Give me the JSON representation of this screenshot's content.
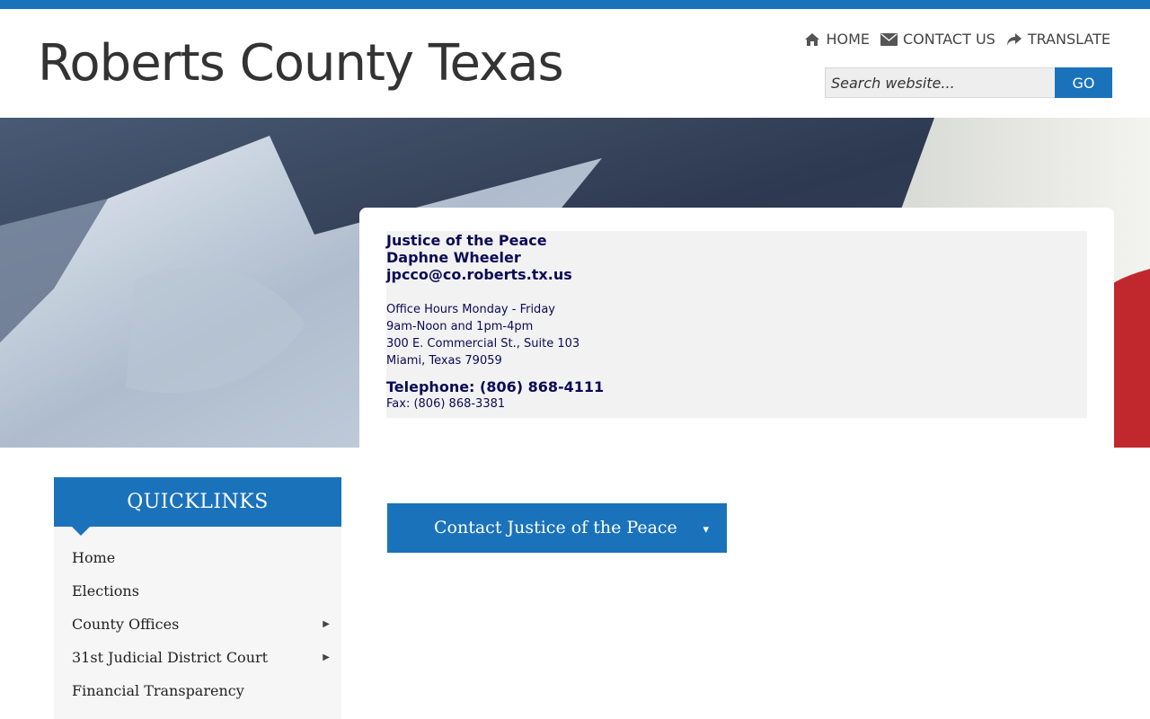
{
  "site": {
    "title": "Roberts County Texas"
  },
  "utility_nav": [
    {
      "label": "HOME",
      "icon": "home-icon"
    },
    {
      "label": "CONTACT US",
      "icon": "envelope-icon"
    },
    {
      "label": "TRANSLATE",
      "icon": "share-arrow-icon"
    }
  ],
  "search": {
    "placeholder": "Search website...",
    "button_label": "GO"
  },
  "office": {
    "title": "Justice of the Peace",
    "name": "Daphne Wheeler",
    "email": "jpcco@co.roberts.tx.us",
    "hours_line1": "Office Hours Monday - Friday",
    "hours_line2": "9am-Noon and 1pm-4pm",
    "address_line1": "300 E. Commercial St., Suite 103",
    "address_line2": "Miami, Texas 79059",
    "telephone": "Telephone: (806) 868-4111",
    "fax": "Fax:  (806) 868-3381"
  },
  "quicklinks": {
    "title": "QUICKLINKS",
    "items": [
      {
        "label": "Home"
      },
      {
        "label": "Elections"
      },
      {
        "label": "County Offices"
      },
      {
        "label": "31st Judicial District Court"
      },
      {
        "label": "Financial Transparency"
      }
    ]
  },
  "contact_dropdown": {
    "label": "Contact Justice of the Peace",
    "caret": "▾"
  },
  "colors": {
    "brand_blue": "#1a72bb",
    "text_navy": "#0a0a55",
    "flag_red": "#c0282d"
  }
}
